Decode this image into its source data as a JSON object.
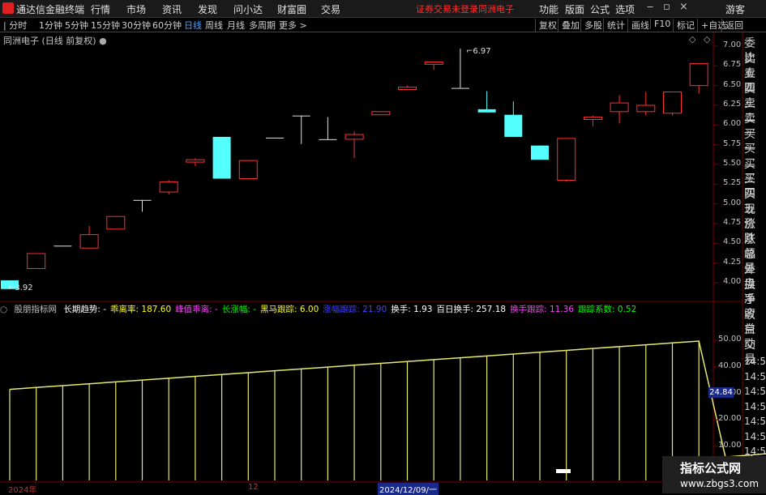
{
  "titlebar": {
    "app_name": "通达信金融终端",
    "menus": [
      "行情",
      "市场",
      "资讯",
      "发现",
      "问小达",
      "财富圈",
      "交易"
    ],
    "warning": "证券交易未登录",
    "stock": "同洲电子",
    "tools": [
      "功能",
      "版面",
      "公式",
      "选项"
    ],
    "guest": "游客"
  },
  "periods": {
    "items": [
      "分时",
      "1分钟",
      "5分钟",
      "15分钟",
      "30分钟",
      "60分钟",
      "日线",
      "周线",
      "月线",
      "多周期",
      "更多 >"
    ],
    "active": "日线"
  },
  "right_buttons": [
    "复权",
    "叠加",
    "多股",
    "统计",
    "画线",
    "F10",
    "标记",
    "+自选",
    "返回"
  ],
  "chart_header": "同洲电子 (日线 前复权)",
  "side_labels": [
    "委比",
    "卖五",
    "卖四",
    "卖三",
    "卖二",
    "卖一",
    "买一",
    "买二",
    "买三",
    "买四",
    "买五",
    "现价",
    "涨跌",
    "涨幅",
    "总量",
    "外盘",
    "换手",
    "净资",
    "收益",
    "自动",
    "交易"
  ],
  "side_times": [
    "14:56",
    "14:56",
    "14:56",
    "14:56",
    "14:56",
    "14:56",
    "14:56",
    "14:56",
    "14:56"
  ],
  "price_axis": [
    "7.00",
    "6.75",
    "6.50",
    "6.25",
    "6.00",
    "5.75",
    "5.50",
    "5.25",
    "5.00",
    "4.75",
    "4.50",
    "4.25",
    "4.00"
  ],
  "high_label": "6.97",
  "low_label": "3.92",
  "indicator": {
    "name": "股朋指标网",
    "items": [
      {
        "label": "长期趋势:",
        "value": "-",
        "color": "#ffffff"
      },
      {
        "label": "乖离率:",
        "value": "187.60",
        "color": "#ffff00"
      },
      {
        "label": "峰值乖离:",
        "value": "-",
        "color": "#ff40ff"
      },
      {
        "label": "长涨幅:",
        "value": "-",
        "color": "#00ff00"
      },
      {
        "label": "黑马跟踪:",
        "value": "6.00",
        "color": "#ffff00"
      },
      {
        "label": "涨幅跟踪:",
        "value": "21.90",
        "color": "#4040ff"
      },
      {
        "label": "换手:",
        "value": "1.93",
        "color": "#ffffff"
      },
      {
        "label": "百日换手:",
        "value": "257.18",
        "color": "#ffffff"
      },
      {
        "label": "换手跟踪:",
        "value": "11.36",
        "color": "#ff40ff"
      },
      {
        "label": "跟踪系数:",
        "value": "0.52",
        "color": "#00ff00"
      }
    ]
  },
  "indicator_axis": [
    "50.00",
    "40.00",
    "30.00",
    "20.00",
    "10.00"
  ],
  "indicator_current": "24.84",
  "x_labels": [
    "2024年",
    "12",
    "2024/12/09/一"
  ],
  "watermark": {
    "title": "指标公式网",
    "url": "www.zbgs3.com"
  },
  "chart_data": {
    "type": "candlestick",
    "ylim": [
      3.9,
      7.0
    ],
    "candles": [
      {
        "o": 4.03,
        "h": 4.03,
        "c": 3.92,
        "l": 3.92
      },
      {
        "o": 4.18,
        "h": 4.25,
        "c": 4.37,
        "l": 4.18
      },
      {
        "o": 4.47,
        "h": 4.47,
        "c": 4.47,
        "l": 4.47
      },
      {
        "o": 4.44,
        "h": 4.72,
        "c": 4.61,
        "l": 4.44
      },
      {
        "o": 4.68,
        "h": 4.84,
        "c": 4.84,
        "l": 4.68
      },
      {
        "o": 5.05,
        "h": 5.05,
        "c": 5.05,
        "l": 4.9
      },
      {
        "o": 5.15,
        "h": 5.3,
        "c": 5.28,
        "l": 5.12
      },
      {
        "o": 5.53,
        "h": 5.58,
        "c": 5.56,
        "l": 5.48
      },
      {
        "o": 5.85,
        "h": 5.85,
        "c": 5.32,
        "l": 5.32
      },
      {
        "o": 5.32,
        "h": 5.55,
        "c": 5.55,
        "l": 5.32
      },
      {
        "o": 5.84,
        "h": 5.84,
        "c": 5.84,
        "l": 5.84
      },
      {
        "o": 6.12,
        "h": 6.12,
        "c": 6.12,
        "l": 5.76
      },
      {
        "o": 5.82,
        "h": 6.1,
        "c": 5.82,
        "l": 5.82
      },
      {
        "o": 5.82,
        "h": 5.92,
        "c": 5.88,
        "l": 5.58
      },
      {
        "o": 6.13,
        "h": 6.17,
        "c": 6.17,
        "l": 6.13
      },
      {
        "o": 6.45,
        "h": 6.5,
        "c": 6.48,
        "l": 6.45
      },
      {
        "o": 6.77,
        "h": 6.8,
        "c": 6.8,
        "l": 6.7
      },
      {
        "o": 6.47,
        "h": 6.97,
        "c": 6.47,
        "l": 6.47
      },
      {
        "o": 6.2,
        "h": 6.43,
        "c": 6.16,
        "l": 6.16
      },
      {
        "o": 6.13,
        "h": 6.3,
        "c": 5.85,
        "l": 5.85
      },
      {
        "o": 5.74,
        "h": 5.74,
        "c": 5.56,
        "l": 5.56
      },
      {
        "o": 5.3,
        "h": 5.83,
        "c": 5.83,
        "l": 5.28
      },
      {
        "o": 6.07,
        "h": 6.12,
        "c": 6.1,
        "l": 5.98
      },
      {
        "o": 6.17,
        "h": 6.38,
        "c": 6.28,
        "l": 6.02
      },
      {
        "o": 6.17,
        "h": 6.42,
        "c": 6.25,
        "l": 6.12
      },
      {
        "o": 6.15,
        "h": 6.42,
        "c": 6.42,
        "l": 6.12
      },
      {
        "o": 6.5,
        "h": 6.78,
        "c": 6.78,
        "l": 6.4
      }
    ],
    "indicator_ylim": [
      5,
      52
    ],
    "indicator_line": [
      31.5,
      32.2,
      32.9,
      33.6,
      34.3,
      35.0,
      35.7,
      36.4,
      37.1,
      37.8,
      38.5,
      39.2,
      39.9,
      40.6,
      41.3,
      42.0,
      42.7,
      43.4,
      44.1,
      44.8,
      45.5,
      46.2,
      46.9,
      47.6,
      48.3,
      49.0,
      49.7,
      6.0,
      6.8,
      7.6,
      8.4,
      9.2,
      10.0
    ]
  }
}
